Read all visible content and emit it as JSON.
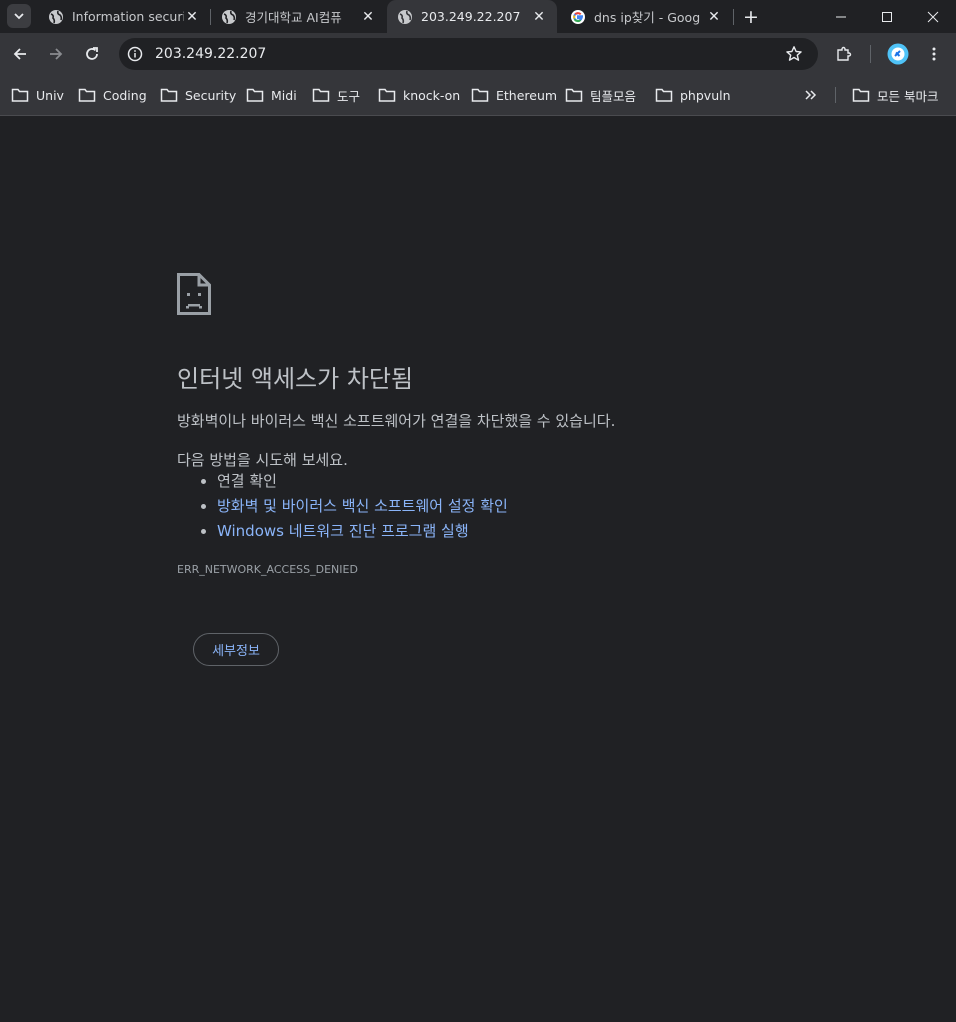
{
  "tabs": [
    {
      "title": "Information securit",
      "favicon": "globe-icon",
      "active": false
    },
    {
      "title": "경기대학교 AI컴퓨",
      "favicon": "globe-icon",
      "active": false
    },
    {
      "title": "203.249.22.207",
      "favicon": "globe-icon",
      "active": true
    },
    {
      "title": "dns ip찾기 - Goog",
      "favicon": "google-g-icon",
      "active": false
    }
  ],
  "toolbar": {
    "url": "203.249.22.207",
    "site_info_icon": "info-icon",
    "bookmark_star_icon": "star-icon",
    "extensions_icon": "puzzle-icon",
    "profile_icon": "profile-avatar-icon"
  },
  "bookmarks": {
    "items": [
      "Univ",
      "Coding",
      "Security",
      "Midi",
      "도구",
      "knock-on",
      "Ethereum",
      "팀플모음",
      "phpvuln"
    ],
    "overflow_icon": "chevron-double-right-icon",
    "all_bookmarks": "모든 북마크"
  },
  "error": {
    "icon": "sad-page-icon",
    "heading": "인터넷 액세스가 차단됨",
    "description": "방화벽이나 바이러스 백신 소프트웨어가 연결을 차단했을 수 있습니다.",
    "try_label": "다음 방법을 시도해 보세요.",
    "suggestions": [
      {
        "text": "연결 확인",
        "link": false
      },
      {
        "text": "방화벽 및 바이러스 백신 소프트웨어 설정 확인",
        "link": true
      },
      {
        "text": "Windows 네트워크 진단 프로그램 실행",
        "link": true
      }
    ],
    "code": "ERR_NETWORK_ACCESS_DENIED",
    "details_button": "세부정보"
  },
  "colors": {
    "page_bg": "#202124",
    "chrome_bg": "#35363a",
    "link": "#8ab4f8",
    "text": "#bdc1c6"
  }
}
